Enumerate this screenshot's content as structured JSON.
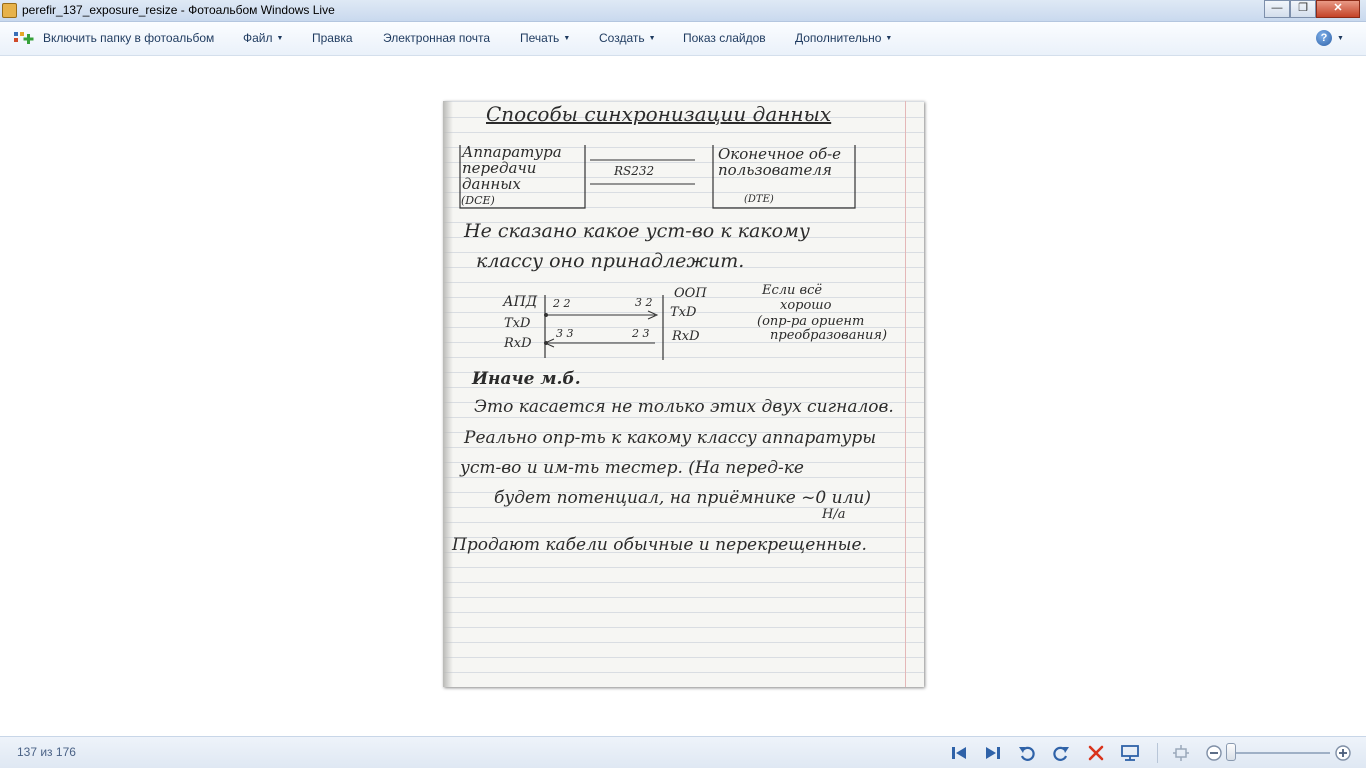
{
  "window": {
    "title": "perefir_137_exposure_resize - Фотоальбом Windows Live",
    "minimize_label": "—",
    "restore_label": "❐",
    "close_label": "✕"
  },
  "menu": {
    "add_folder": "Включить папку в фотоальбом",
    "file": "Файл",
    "edit": "Правка",
    "email": "Электронная почта",
    "print": "Печать",
    "create": "Создать",
    "slideshow": "Показ слайдов",
    "more": "Дополнительно",
    "help": "?"
  },
  "photo": {
    "lines": {
      "title": "Способы синхронизации данных",
      "dce": "Аппаратура передачи данных",
      "dce_abbr": "(DCE)",
      "rs232": "RS232",
      "dte": "Оконечное об-е пользователя",
      "dte_abbr": "(DTE)",
      "p1a": "Не сказано какое уст-во к какому",
      "p1b": "классу оно принадлежит.",
      "apd": "АПД",
      "txd_l": "TxD",
      "rxd_l": "RxD",
      "oop": "ООП",
      "txd_r": "TxD",
      "rxd_r": "RxD",
      "n22a": "2 2",
      "n32": "3 2",
      "n33": "3 3",
      "n23": "2 3",
      "note1": "Если всё",
      "note2": "хорошо",
      "note3": "(опр-ра ориент",
      "note4": "преобразования)",
      "h2": "Иначе м.б.",
      "p2a": "Это касается не только этих двух сигналов.",
      "p2b": "Реально опр-ть к какому классу аппаратуры",
      "p2c": "уст-во и им-ть тестер. (На перед-ке",
      "p2d": "будет потенциал, на приёмнике ~0 или)",
      "p2e": "Н/а",
      "p3": "Продают кабели обычные и перекрещенные."
    }
  },
  "status": {
    "counter": "137 из 176"
  },
  "zoom": {
    "level_fraction": 0.0
  },
  "colors": {
    "accent": "#2f62a8",
    "delete": "#d9331c",
    "ink": "#2b2b2b"
  },
  "icons": [
    "app-icon",
    "add-folder-icon",
    "help-icon",
    "previous-icon",
    "next-icon",
    "rotate-left-icon",
    "rotate-right-icon",
    "delete-icon",
    "slideshow-icon",
    "fit-icon",
    "zoom-out-icon",
    "zoom-in-icon"
  ]
}
